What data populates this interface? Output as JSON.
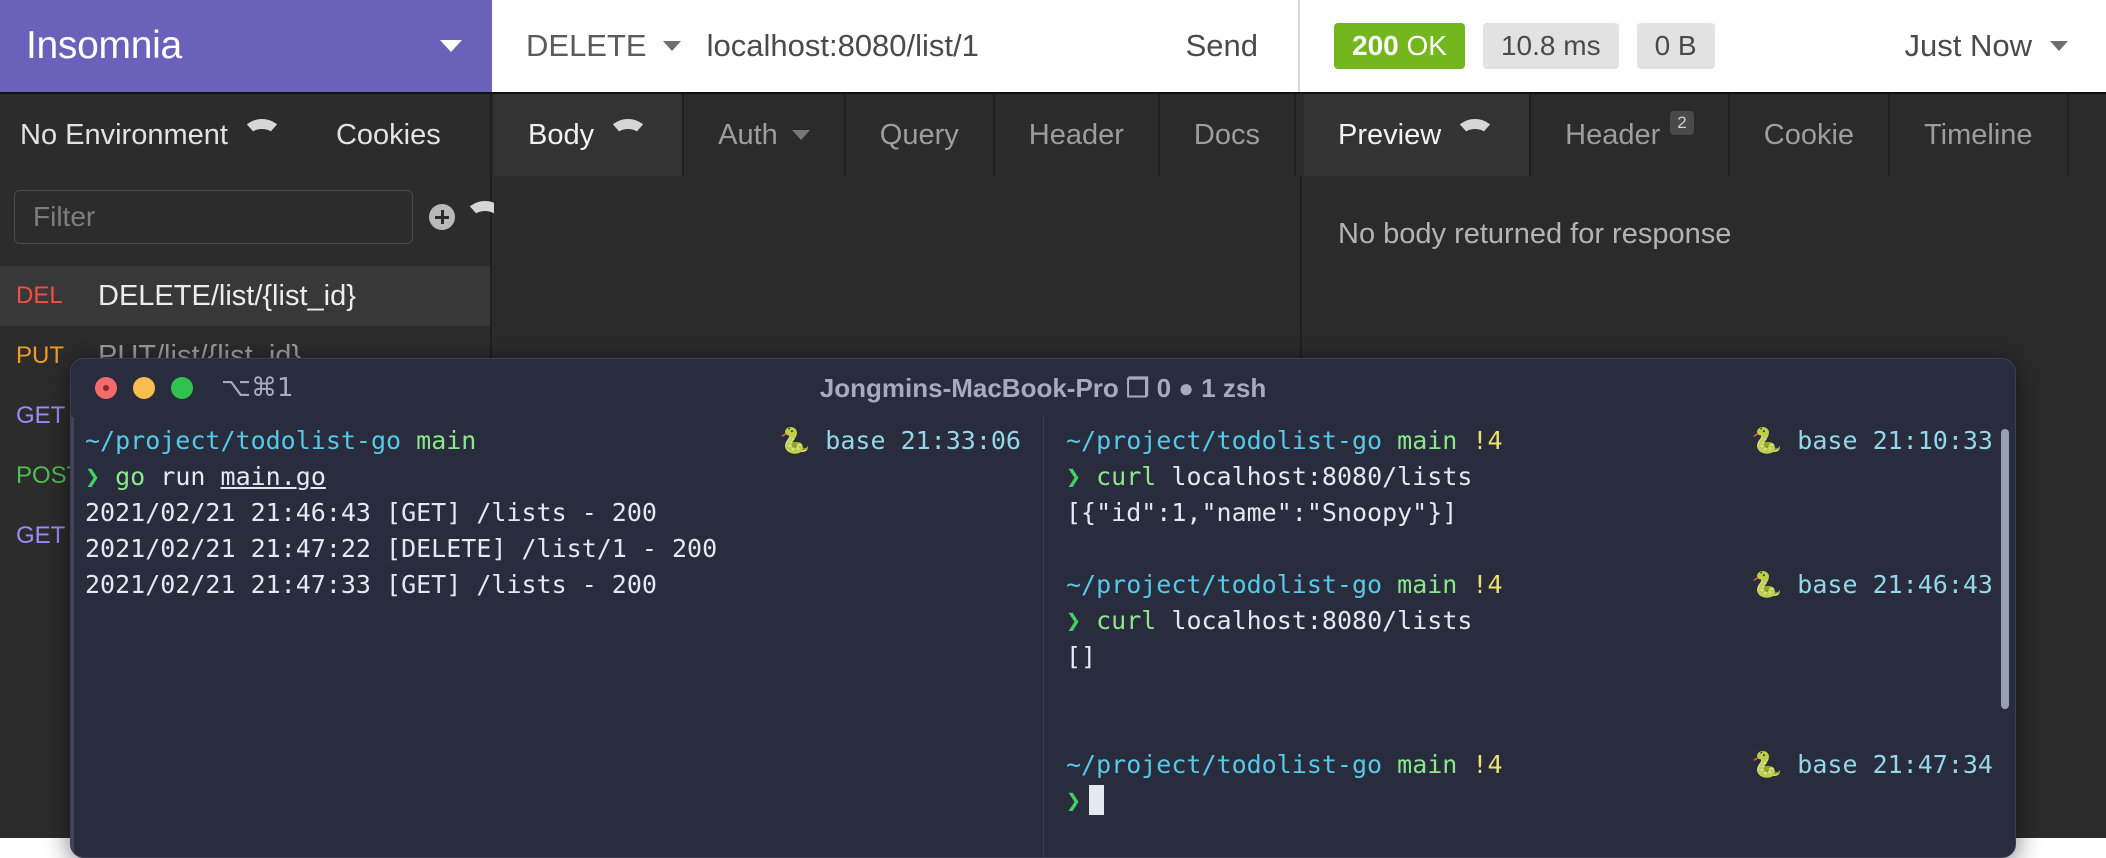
{
  "brand": {
    "title": "Insomnia",
    "caret_icon": "chevron-down-icon"
  },
  "request_bar": {
    "method": "DELETE",
    "method_caret_icon": "chevron-down-icon",
    "url": "localhost:8080/list/1",
    "send_label": "Send"
  },
  "response_bar": {
    "status_code": "200",
    "status_text": "OK",
    "time": "10.8 ms",
    "size": "0 B",
    "history_label": "Just Now",
    "history_caret_icon": "chevron-down-icon",
    "status_color": "#74b61e"
  },
  "sidebar": {
    "environment_label": "No Environment",
    "environment_caret_icon": "chevron-down-icon",
    "cookies_label": "Cookies",
    "filter_placeholder": "Filter",
    "filter_value": "",
    "add_icon": "plus-circle-icon",
    "add_caret_icon": "chevron-down-icon",
    "requests": [
      {
        "method": "DEL",
        "name": "DELETE/list/{list_id}",
        "color": "#f2503f",
        "selected": true
      },
      {
        "method": "PUT",
        "name": "PUT/list/{list_id}",
        "color": "#f49c21",
        "selected": false
      },
      {
        "method": "GET",
        "name": "",
        "color": "#9c8cf5",
        "selected": false
      },
      {
        "method": "POST",
        "name": "",
        "color": "#4fc04f",
        "selected": false
      },
      {
        "method": "GET",
        "name": "",
        "color": "#9c8cf5",
        "selected": false
      }
    ]
  },
  "request_tabs": [
    {
      "label": "Body",
      "caret_icon": "chevron-down-icon",
      "active": true,
      "badge": ""
    },
    {
      "label": "Auth",
      "caret_icon": "chevron-down-icon",
      "active": false,
      "badge": ""
    },
    {
      "label": "Query",
      "caret_icon": "",
      "active": false,
      "badge": ""
    },
    {
      "label": "Header",
      "caret_icon": "",
      "active": false,
      "badge": ""
    },
    {
      "label": "Docs",
      "caret_icon": "",
      "active": false,
      "badge": ""
    }
  ],
  "response_tabs": [
    {
      "label": "Preview",
      "caret_icon": "chevron-down-icon",
      "active": true,
      "badge": ""
    },
    {
      "label": "Header",
      "caret_icon": "",
      "active": false,
      "badge": "2"
    },
    {
      "label": "Cookie",
      "caret_icon": "",
      "active": false,
      "badge": ""
    },
    {
      "label": "Timeline",
      "caret_icon": "",
      "active": false,
      "badge": ""
    }
  ],
  "response_body": {
    "empty_message": "No body returned for response"
  },
  "terminal": {
    "title": "Jongmins-MacBook-Pro ❐ 0 ● 1 zsh",
    "shortcut": "⌥⌘1",
    "window_buttons": [
      "close-button",
      "minimize-button",
      "zoom-button"
    ],
    "left_pane": {
      "prompt_path": "~/project/todolist-go",
      "prompt_branch": "main",
      "prompt_flag": "",
      "env_name": "base",
      "timestamp": "21:33:06",
      "command_symbol": "❯",
      "command": "go run main.go",
      "command_program": "go",
      "command_arg_prefix": "run ",
      "command_file": "main.go",
      "output": [
        "2021/02/21 21:46:43 [GET] /lists - 200",
        "2021/02/21 21:47:22 [DELETE] /list/1 - 200",
        "2021/02/21 21:47:33 [GET] /lists - 200"
      ]
    },
    "right_pane": {
      "blocks": [
        {
          "prompt_path": "~/project/todolist-go",
          "prompt_branch": "main",
          "prompt_flag": "!4",
          "env_name": "base",
          "timestamp": "21:10:33",
          "command_symbol": "❯",
          "command_program": "curl",
          "command_args": "localhost:8080/lists",
          "output": "[{\"id\":1,\"name\":\"Snoopy\"}]"
        },
        {
          "prompt_path": "~/project/todolist-go",
          "prompt_branch": "main",
          "prompt_flag": "!4",
          "env_name": "base",
          "timestamp": "21:46:43",
          "command_symbol": "❯",
          "command_program": "curl",
          "command_args": "localhost:8080/lists",
          "output": "[]"
        },
        {
          "prompt_path": "~/project/todolist-go",
          "prompt_branch": "main",
          "prompt_flag": "!4",
          "env_name": "base",
          "timestamp": "21:47:34",
          "command_symbol": "❯",
          "command_program": "",
          "command_args": "",
          "output": ""
        }
      ]
    }
  }
}
